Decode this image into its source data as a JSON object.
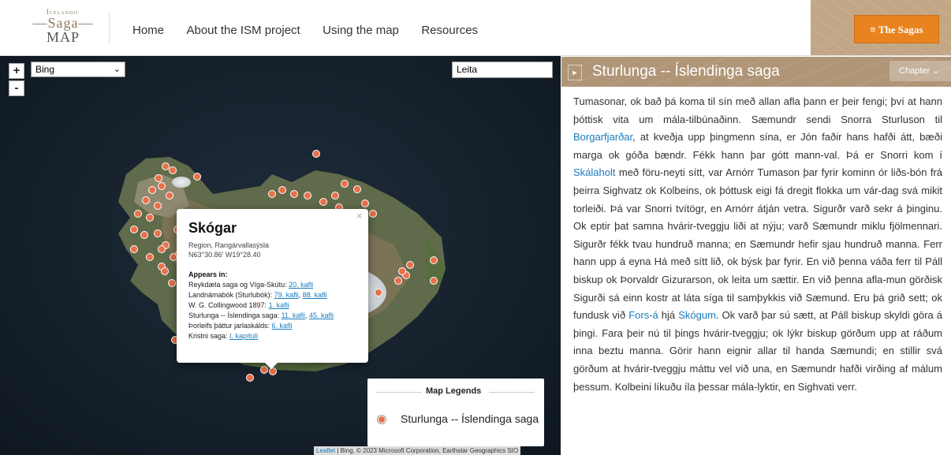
{
  "header": {
    "logo": {
      "line1": "Icelandic",
      "line2": "—Saga—",
      "line3": "MAP"
    },
    "nav": [
      "Home",
      "About the ISM project",
      "Using the map",
      "Resources"
    ],
    "sagas_button": "≡  The Sagas"
  },
  "map": {
    "zoom_in": "+",
    "zoom_out": "-",
    "layer_select": "Bing",
    "search_value": "Leita",
    "popup": {
      "close": "×",
      "title": "Skógar",
      "region": "Region, Rangárvallasýsla",
      "coords": "N63°30.86' W19°28.40",
      "appears_label": "Appears in:",
      "lines": [
        {
          "text": "Reykdæla saga og Víga-Skútu: ",
          "links": [
            "20. kafli"
          ]
        },
        {
          "text": "Landnámabók (Sturlubók): ",
          "links": [
            "79. kafli",
            "88. kafli"
          ]
        },
        {
          "text": "W. G. Collingwood 1897: ",
          "links": [
            "1. kafli"
          ]
        },
        {
          "text": "Sturlunga -- Íslendinga saga: ",
          "links": [
            "11. kafli",
            "45. kafli"
          ]
        },
        {
          "text": "Þorleifs þáttur jarlaskálds: ",
          "links": [
            "6. kafli"
          ]
        },
        {
          "text": "Kristni saga: ",
          "links": [
            "I. kapítuli"
          ]
        }
      ]
    },
    "legend": {
      "title": "Map Legends",
      "item": "Sturlunga -- Íslendinga saga",
      "marker_color": "#e8704a"
    },
    "attribution": {
      "link": "Leaflet",
      "text": " | Bing, © 2023 Microsoft Corporation, Earthstar Geographics SIO"
    }
  },
  "reader": {
    "title": "Sturlunga -- Íslendinga saga",
    "chapter_label": "Chapter",
    "paragraph": [
      {
        "t": "Tumasonar, ok bað þá koma til sín með allan afla þann er þeir fengi; því at hann þóttisk vita um mála-tilbúnaðinn. Sæmundr sendi Snorra Sturluson til "
      },
      {
        "t": "Borgarfjarðar",
        "link": true
      },
      {
        "t": ", at kveðja upp þingmenn sína, er Jón faðir hans hafði átt, bæði marga ok góða bændr. Fékk hann þar gótt mann-val. Þá er Snorri kom í "
      },
      {
        "t": "Skálaholt",
        "link": true
      },
      {
        "t": " með föru-neyti sítt, var Arnórr Tumason þar fyrir kominn ór liðs-bón frá þeirra Sighvatz ok Kolbeins, ok þóttusk eigi fá dregit flokka um vár-dag svá mikit torleiði. Þá var Snorri tvítögr, en Arnórr átján vetra. Sigurðr varð sekr á þinginu. Ok eptir þat samna hvárir-tveggju liði at nýju; varð Sæmundr miklu fjölmennari. Sigurðr fékk tvau hundruð manna; en Sæmundr hefir sjau hundruð manna. Ferr hann upp á eyna Há með sítt lið, ok býsk þar fyrir. En við þenna váða ferr til Páll biskup ok Þorvaldr Gizurarson, ok leita um sættir. En við þenna afla-mun görðisk Sigurði sá einn kostr at láta síga til samþykkis við Sæmund. Eru þá grið sett; ok fundusk við "
      },
      {
        "t": "Fors-á",
        "link": true
      },
      {
        "t": " hjá "
      },
      {
        "t": "Skógum",
        "link": true
      },
      {
        "t": ". Ok varð þar sú sætt, at Páll biskup skyldi göra á þingi. Fara þeir nú til þings hvárir-tveggju; ok lýkr biskup görðum upp at ráðum inna beztu manna. Görir hann eignir allar til handa Sæmundi; en stillir svá görðum at hvárir-tveggju máttu vel við una, en Sæmundr hafði virðing af málum þessum. Kolbeini líkuðu íla þessar mála-lyktir, en Sighvati verr."
      }
    ]
  }
}
